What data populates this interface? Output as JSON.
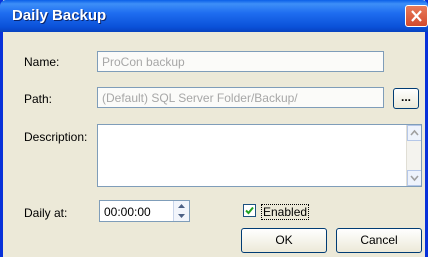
{
  "window": {
    "title": "Daily Backup"
  },
  "form": {
    "name_label": "Name:",
    "name_value": "ProCon backup",
    "path_label": "Path:",
    "path_value": "(Default) SQL Server Folder/Backup/",
    "browse_label": "...",
    "description_label": "Description:",
    "description_value": "",
    "daily_at_label": "Daily at:",
    "time_value": "00:00:00",
    "enabled_label": "Enabled",
    "enabled_checked": true
  },
  "buttons": {
    "ok_label": "OK",
    "cancel_label": "Cancel"
  },
  "icons": {
    "close": "close-icon",
    "up": "scroll-up-icon",
    "down": "scroll-down-icon",
    "check": "checkmark-icon"
  }
}
